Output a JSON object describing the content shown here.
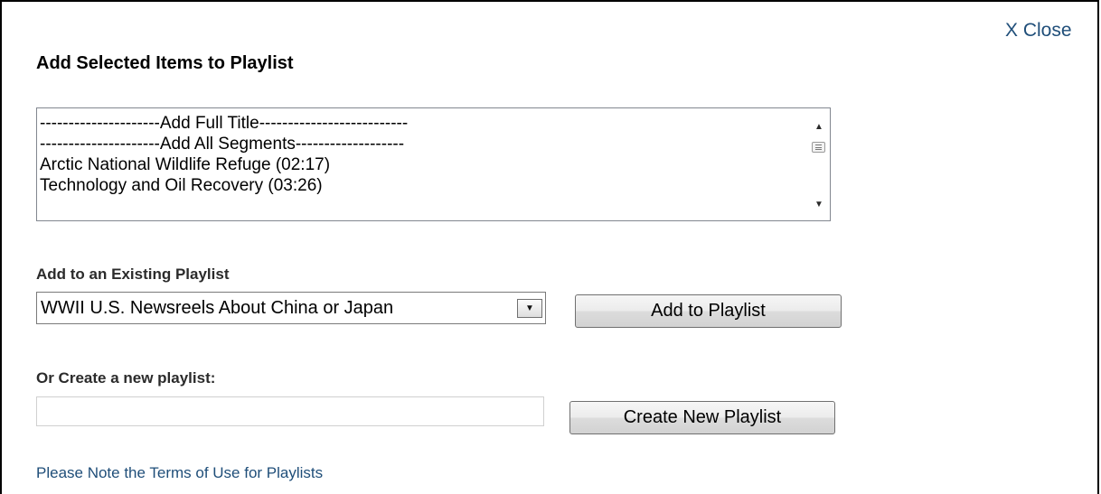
{
  "dialog": {
    "close_label": "X Close",
    "title": "Add Selected Items to Playlist"
  },
  "segments_list": {
    "options": [
      "---------------------Add Full Title--------------------------",
      "---------------------Add All Segments-------------------",
      "Arctic National Wildlife Refuge (02:17)",
      "Technology and Oil Recovery (03:26)"
    ]
  },
  "existing_playlist": {
    "label": "Add to an Existing Playlist",
    "selected_value": "WWII U.S. Newsreels About China or Japan",
    "button_label": "Add to Playlist"
  },
  "new_playlist": {
    "label": "Or Create a new playlist:",
    "input_value": "",
    "button_label": "Create New Playlist"
  },
  "footer": {
    "terms_link": "Please Note the Terms of Use for Playlists"
  },
  "colors": {
    "link": "#1f4e79",
    "border": "#000000"
  },
  "icons": {
    "scroll_up": "arrow-up-icon",
    "scroll_down": "arrow-down-icon",
    "select_arrow": "chevron-down-icon"
  }
}
